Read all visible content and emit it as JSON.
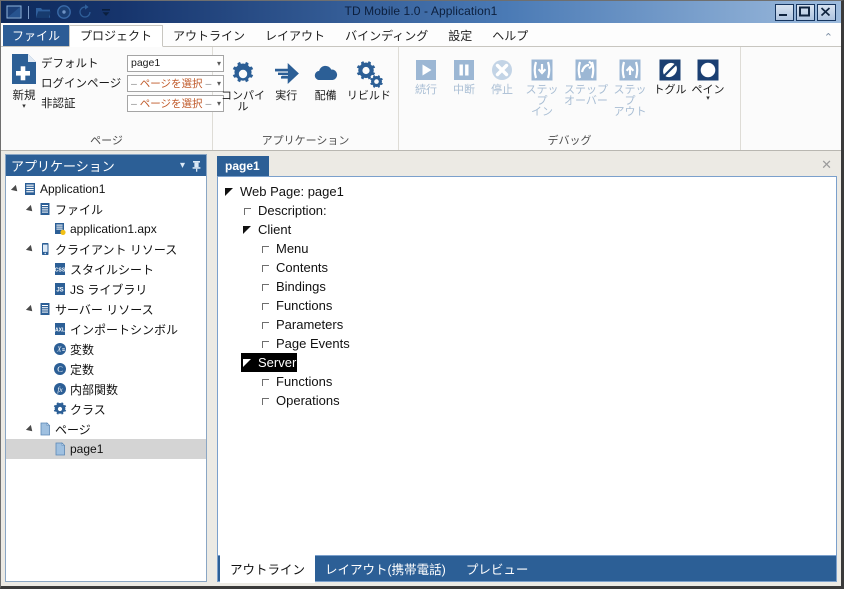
{
  "window": {
    "title": "TD Mobile 1.0 - Application1",
    "quick_access": [
      {
        "name": "app-logo-icon",
        "label": "TD"
      },
      {
        "name": "open-folder-icon",
        "label": "Open"
      },
      {
        "name": "save-icon",
        "label": "Save"
      },
      {
        "name": "undo-icon",
        "label": "Undo"
      },
      {
        "name": "customize-qat-icon",
        "label": "Customize"
      }
    ],
    "buttons": {
      "minimize": "–",
      "maximize": "❐",
      "close": "✕"
    }
  },
  "ribbon": {
    "tabs": [
      {
        "label": "ファイル",
        "state": "file"
      },
      {
        "label": "プロジェクト",
        "state": "active"
      },
      {
        "label": "アウトライン",
        "state": "normal"
      },
      {
        "label": "レイアウト",
        "state": "normal"
      },
      {
        "label": "バインディング",
        "state": "normal"
      },
      {
        "label": "設定",
        "state": "normal"
      },
      {
        "label": "ヘルプ",
        "state": "normal"
      }
    ],
    "collapse_icon": "⌃",
    "groups": {
      "page": {
        "title": "ページ",
        "new_button": {
          "label": "新規",
          "caret": "▾"
        },
        "fields": [
          {
            "label": "デフォルト",
            "value": "page1",
            "placeholder": false
          },
          {
            "label": "ログインページ",
            "value": "ページを選択",
            "placeholder": true
          },
          {
            "label": "非認証",
            "value": "ページを選択",
            "placeholder": true
          }
        ],
        "caret": "▾"
      },
      "application": {
        "title": "アプリケーション",
        "buttons": [
          {
            "label": "コンパイル",
            "icon": "gear-icon",
            "enabled": true
          },
          {
            "label": "実行",
            "icon": "run-arrow-icon",
            "enabled": true
          },
          {
            "label": "配備",
            "icon": "cloud-icon",
            "enabled": true
          },
          {
            "label": "リビルド",
            "icon": "gears-icon",
            "enabled": true
          }
        ]
      },
      "debug": {
        "title": "デバッグ",
        "buttons": [
          {
            "label": "続行",
            "icon": "play-icon",
            "enabled": false
          },
          {
            "label": "中断",
            "icon": "pause-icon",
            "enabled": false
          },
          {
            "label": "停止",
            "icon": "stop-x-icon",
            "enabled": false
          },
          {
            "label": "ステップ\nイン",
            "icon": "step-into-icon",
            "enabled": false
          },
          {
            "label": "ステップ\nオーバー",
            "icon": "step-over-icon",
            "enabled": false
          },
          {
            "label": "ステップ\nアウト",
            "icon": "step-out-icon",
            "enabled": false
          },
          {
            "label": "トグル",
            "icon": "toggle-breakpoint-icon",
            "enabled": true
          },
          {
            "label": "ペイン",
            "icon": "pane-icon",
            "enabled": true,
            "caret": "▾"
          }
        ]
      }
    }
  },
  "left_panel": {
    "title": "アプリケーション",
    "dropdown_icon": "▾",
    "pin_icon": "pin",
    "tree": [
      {
        "label": "Application1",
        "depth": 0,
        "twisty": "expanded",
        "icon": "application-icon",
        "selected": false
      },
      {
        "label": "ファイル",
        "depth": 1,
        "twisty": "expanded",
        "icon": "file-folder-icon",
        "selected": false
      },
      {
        "label": "application1.apx",
        "depth": 2,
        "twisty": "none",
        "icon": "apx-file-icon",
        "selected": false
      },
      {
        "label": "クライアント リソース",
        "depth": 1,
        "twisty": "expanded",
        "icon": "mobile-device-icon",
        "selected": false
      },
      {
        "label": "スタイルシート",
        "depth": 2,
        "twisty": "none",
        "icon": "css-icon",
        "selected": false
      },
      {
        "label": "JS ライブラリ",
        "depth": 2,
        "twisty": "none",
        "icon": "js-icon",
        "selected": false
      },
      {
        "label": "サーバー リソース",
        "depth": 1,
        "twisty": "expanded",
        "icon": "server-resource-icon",
        "selected": false
      },
      {
        "label": "インポートシンボル",
        "depth": 2,
        "twisty": "none",
        "icon": "axl-icon",
        "selected": false
      },
      {
        "label": "変数",
        "depth": 2,
        "twisty": "none",
        "icon": "variable-icon",
        "selected": false
      },
      {
        "label": "定数",
        "depth": 2,
        "twisty": "none",
        "icon": "constant-icon",
        "selected": false
      },
      {
        "label": "内部関数",
        "depth": 2,
        "twisty": "none",
        "icon": "function-icon",
        "selected": false
      },
      {
        "label": "クラス",
        "depth": 2,
        "twisty": "none",
        "icon": "class-gear-icon",
        "selected": false
      },
      {
        "label": "ページ",
        "depth": 1,
        "twisty": "expanded",
        "icon": "page-icon",
        "selected": false
      },
      {
        "label": "page1",
        "depth": 2,
        "twisty": "none",
        "icon": "page-icon",
        "selected": true
      }
    ]
  },
  "document": {
    "tab_label": "page1",
    "close_icon": "✕",
    "outline": [
      {
        "label": "Web Page: page1",
        "depth": 0,
        "marker": "expanded",
        "selected": false
      },
      {
        "label": "Description:",
        "depth": 1,
        "marker": "leaf",
        "selected": false
      },
      {
        "label": "Client",
        "depth": 1,
        "marker": "expanded",
        "selected": false
      },
      {
        "label": "Menu",
        "depth": 2,
        "marker": "leaf",
        "selected": false
      },
      {
        "label": "Contents",
        "depth": 2,
        "marker": "leaf",
        "selected": false
      },
      {
        "label": "Bindings",
        "depth": 2,
        "marker": "leaf",
        "selected": false
      },
      {
        "label": "Functions",
        "depth": 2,
        "marker": "leaf",
        "selected": false
      },
      {
        "label": "Parameters",
        "depth": 2,
        "marker": "leaf",
        "selected": false
      },
      {
        "label": "Page Events",
        "depth": 2,
        "marker": "leaf",
        "selected": false
      },
      {
        "label": "Server",
        "depth": 1,
        "marker": "expanded",
        "selected": true
      },
      {
        "label": "Functions",
        "depth": 2,
        "marker": "leaf",
        "selected": false
      },
      {
        "label": "Operations",
        "depth": 2,
        "marker": "leaf",
        "selected": false
      }
    ],
    "bottom_tabs": [
      {
        "label": "アウトライン",
        "active": true
      },
      {
        "label": "レイアウト(携帯電話)",
        "active": false
      },
      {
        "label": "プレビュー",
        "active": false
      }
    ]
  },
  "colors": {
    "accent_blue": "#2c5f96",
    "title_dark": "#0e2a5c",
    "ribbon_bg": "#fbfbfb",
    "selection_gray": "#d4d4d4",
    "selection_black": "#000000"
  }
}
